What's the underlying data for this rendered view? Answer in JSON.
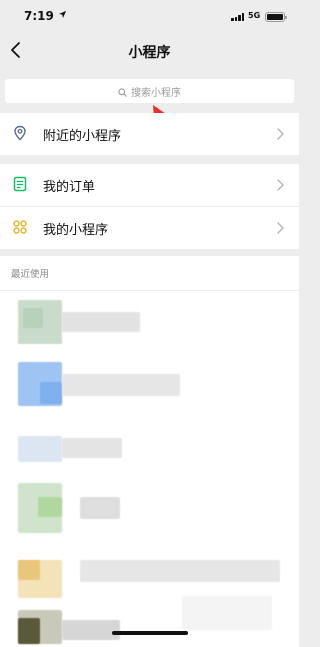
{
  "status_bar": {
    "time": "7:19",
    "network": "5G",
    "icons": [
      "location-arrow-icon",
      "signal-icon",
      "battery-icon"
    ]
  },
  "nav": {
    "title": "小程序",
    "back_icon": "chevron-left-icon"
  },
  "search": {
    "placeholder": "搜索小程序",
    "icon": "search-icon"
  },
  "annotation": {
    "icon": "red-arrow-icon",
    "color": "#e8302a"
  },
  "menu": {
    "nearby": {
      "label": "附近的小程序",
      "icon": "location-pin-icon"
    },
    "orders": {
      "label": "我的订单",
      "icon": "order-list-icon"
    },
    "mine": {
      "label": "我的小程序",
      "icon": "mini-program-icon"
    }
  },
  "recent": {
    "heading": "最近使用",
    "items": [
      "pixelated",
      "pixelated",
      "pixelated",
      "pixelated",
      "pixelated",
      "pixelated"
    ]
  },
  "colors": {
    "background": "#ededed",
    "accent_green": "#07c160",
    "icon_blue": "#576b95",
    "icon_yellow": "#e6b422"
  }
}
